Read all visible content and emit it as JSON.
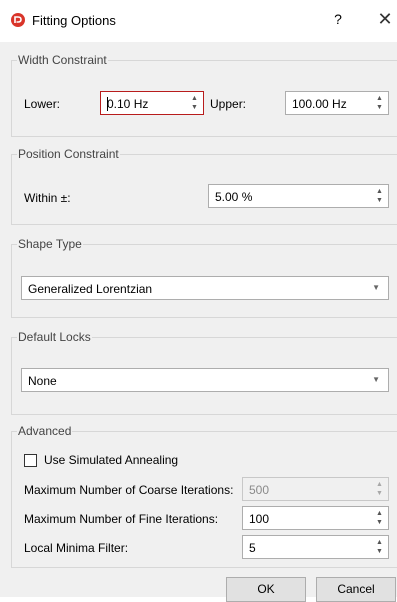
{
  "window": {
    "title": "Fitting Options",
    "help": "?",
    "close": "✕",
    "icon": "app-logo-icon"
  },
  "width_constraint": {
    "legend": "Width Constraint",
    "lower_label": "Lower:",
    "lower_value": "0.10 Hz",
    "upper_label": "Upper:",
    "upper_value": "100.00 Hz"
  },
  "position_constraint": {
    "legend": "Position Constraint",
    "within_label": "Within ±:",
    "within_value": "5.00 %"
  },
  "shape_type": {
    "legend": "Shape Type",
    "selected": "Generalized Lorentzian"
  },
  "default_locks": {
    "legend": "Default Locks",
    "selected": "None"
  },
  "advanced": {
    "legend": "Advanced",
    "annealing_label": "Use Simulated Annealing",
    "annealing_checked": false,
    "coarse_label": "Maximum Number of Coarse Iterations:",
    "coarse_value": "500",
    "fine_label": "Maximum Number of Fine Iterations:",
    "fine_value": "100",
    "minima_label": "Local Minima Filter:",
    "minima_value": "5"
  },
  "buttons": {
    "ok": "OK",
    "cancel": "Cancel"
  },
  "colors": {
    "accent": "#d9352a",
    "focus_border": "#b81c1c",
    "panel_bg": "#f0f0f0"
  }
}
